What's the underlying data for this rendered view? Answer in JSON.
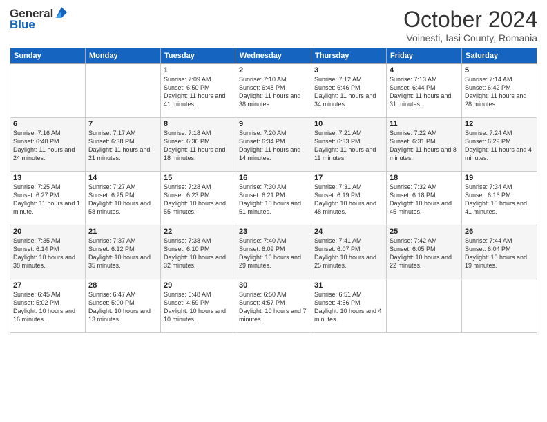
{
  "logo": {
    "general": "General",
    "blue": "Blue"
  },
  "header": {
    "month": "October 2024",
    "location": "Voinesti, Iasi County, Romania"
  },
  "weekdays": [
    "Sunday",
    "Monday",
    "Tuesday",
    "Wednesday",
    "Thursday",
    "Friday",
    "Saturday"
  ],
  "weeks": [
    [
      {
        "day": "",
        "sunrise": "",
        "sunset": "",
        "daylight": ""
      },
      {
        "day": "",
        "sunrise": "",
        "sunset": "",
        "daylight": ""
      },
      {
        "day": "1",
        "sunrise": "Sunrise: 7:09 AM",
        "sunset": "Sunset: 6:50 PM",
        "daylight": "Daylight: 11 hours and 41 minutes."
      },
      {
        "day": "2",
        "sunrise": "Sunrise: 7:10 AM",
        "sunset": "Sunset: 6:48 PM",
        "daylight": "Daylight: 11 hours and 38 minutes."
      },
      {
        "day": "3",
        "sunrise": "Sunrise: 7:12 AM",
        "sunset": "Sunset: 6:46 PM",
        "daylight": "Daylight: 11 hours and 34 minutes."
      },
      {
        "day": "4",
        "sunrise": "Sunrise: 7:13 AM",
        "sunset": "Sunset: 6:44 PM",
        "daylight": "Daylight: 11 hours and 31 minutes."
      },
      {
        "day": "5",
        "sunrise": "Sunrise: 7:14 AM",
        "sunset": "Sunset: 6:42 PM",
        "daylight": "Daylight: 11 hours and 28 minutes."
      }
    ],
    [
      {
        "day": "6",
        "sunrise": "Sunrise: 7:16 AM",
        "sunset": "Sunset: 6:40 PM",
        "daylight": "Daylight: 11 hours and 24 minutes."
      },
      {
        "day": "7",
        "sunrise": "Sunrise: 7:17 AM",
        "sunset": "Sunset: 6:38 PM",
        "daylight": "Daylight: 11 hours and 21 minutes."
      },
      {
        "day": "8",
        "sunrise": "Sunrise: 7:18 AM",
        "sunset": "Sunset: 6:36 PM",
        "daylight": "Daylight: 11 hours and 18 minutes."
      },
      {
        "day": "9",
        "sunrise": "Sunrise: 7:20 AM",
        "sunset": "Sunset: 6:34 PM",
        "daylight": "Daylight: 11 hours and 14 minutes."
      },
      {
        "day": "10",
        "sunrise": "Sunrise: 7:21 AM",
        "sunset": "Sunset: 6:33 PM",
        "daylight": "Daylight: 11 hours and 11 minutes."
      },
      {
        "day": "11",
        "sunrise": "Sunrise: 7:22 AM",
        "sunset": "Sunset: 6:31 PM",
        "daylight": "Daylight: 11 hours and 8 minutes."
      },
      {
        "day": "12",
        "sunrise": "Sunrise: 7:24 AM",
        "sunset": "Sunset: 6:29 PM",
        "daylight": "Daylight: 11 hours and 4 minutes."
      }
    ],
    [
      {
        "day": "13",
        "sunrise": "Sunrise: 7:25 AM",
        "sunset": "Sunset: 6:27 PM",
        "daylight": "Daylight: 11 hours and 1 minute."
      },
      {
        "day": "14",
        "sunrise": "Sunrise: 7:27 AM",
        "sunset": "Sunset: 6:25 PM",
        "daylight": "Daylight: 10 hours and 58 minutes."
      },
      {
        "day": "15",
        "sunrise": "Sunrise: 7:28 AM",
        "sunset": "Sunset: 6:23 PM",
        "daylight": "Daylight: 10 hours and 55 minutes."
      },
      {
        "day": "16",
        "sunrise": "Sunrise: 7:30 AM",
        "sunset": "Sunset: 6:21 PM",
        "daylight": "Daylight: 10 hours and 51 minutes."
      },
      {
        "day": "17",
        "sunrise": "Sunrise: 7:31 AM",
        "sunset": "Sunset: 6:19 PM",
        "daylight": "Daylight: 10 hours and 48 minutes."
      },
      {
        "day": "18",
        "sunrise": "Sunrise: 7:32 AM",
        "sunset": "Sunset: 6:18 PM",
        "daylight": "Daylight: 10 hours and 45 minutes."
      },
      {
        "day": "19",
        "sunrise": "Sunrise: 7:34 AM",
        "sunset": "Sunset: 6:16 PM",
        "daylight": "Daylight: 10 hours and 41 minutes."
      }
    ],
    [
      {
        "day": "20",
        "sunrise": "Sunrise: 7:35 AM",
        "sunset": "Sunset: 6:14 PM",
        "daylight": "Daylight: 10 hours and 38 minutes."
      },
      {
        "day": "21",
        "sunrise": "Sunrise: 7:37 AM",
        "sunset": "Sunset: 6:12 PM",
        "daylight": "Daylight: 10 hours and 35 minutes."
      },
      {
        "day": "22",
        "sunrise": "Sunrise: 7:38 AM",
        "sunset": "Sunset: 6:10 PM",
        "daylight": "Daylight: 10 hours and 32 minutes."
      },
      {
        "day": "23",
        "sunrise": "Sunrise: 7:40 AM",
        "sunset": "Sunset: 6:09 PM",
        "daylight": "Daylight: 10 hours and 29 minutes."
      },
      {
        "day": "24",
        "sunrise": "Sunrise: 7:41 AM",
        "sunset": "Sunset: 6:07 PM",
        "daylight": "Daylight: 10 hours and 25 minutes."
      },
      {
        "day": "25",
        "sunrise": "Sunrise: 7:42 AM",
        "sunset": "Sunset: 6:05 PM",
        "daylight": "Daylight: 10 hours and 22 minutes."
      },
      {
        "day": "26",
        "sunrise": "Sunrise: 7:44 AM",
        "sunset": "Sunset: 6:04 PM",
        "daylight": "Daylight: 10 hours and 19 minutes."
      }
    ],
    [
      {
        "day": "27",
        "sunrise": "Sunrise: 6:45 AM",
        "sunset": "Sunset: 5:02 PM",
        "daylight": "Daylight: 10 hours and 16 minutes."
      },
      {
        "day": "28",
        "sunrise": "Sunrise: 6:47 AM",
        "sunset": "Sunset: 5:00 PM",
        "daylight": "Daylight: 10 hours and 13 minutes."
      },
      {
        "day": "29",
        "sunrise": "Sunrise: 6:48 AM",
        "sunset": "Sunset: 4:59 PM",
        "daylight": "Daylight: 10 hours and 10 minutes."
      },
      {
        "day": "30",
        "sunrise": "Sunrise: 6:50 AM",
        "sunset": "Sunset: 4:57 PM",
        "daylight": "Daylight: 10 hours and 7 minutes."
      },
      {
        "day": "31",
        "sunrise": "Sunrise: 6:51 AM",
        "sunset": "Sunset: 4:56 PM",
        "daylight": "Daylight: 10 hours and 4 minutes."
      },
      {
        "day": "",
        "sunrise": "",
        "sunset": "",
        "daylight": ""
      },
      {
        "day": "",
        "sunrise": "",
        "sunset": "",
        "daylight": ""
      }
    ]
  ]
}
